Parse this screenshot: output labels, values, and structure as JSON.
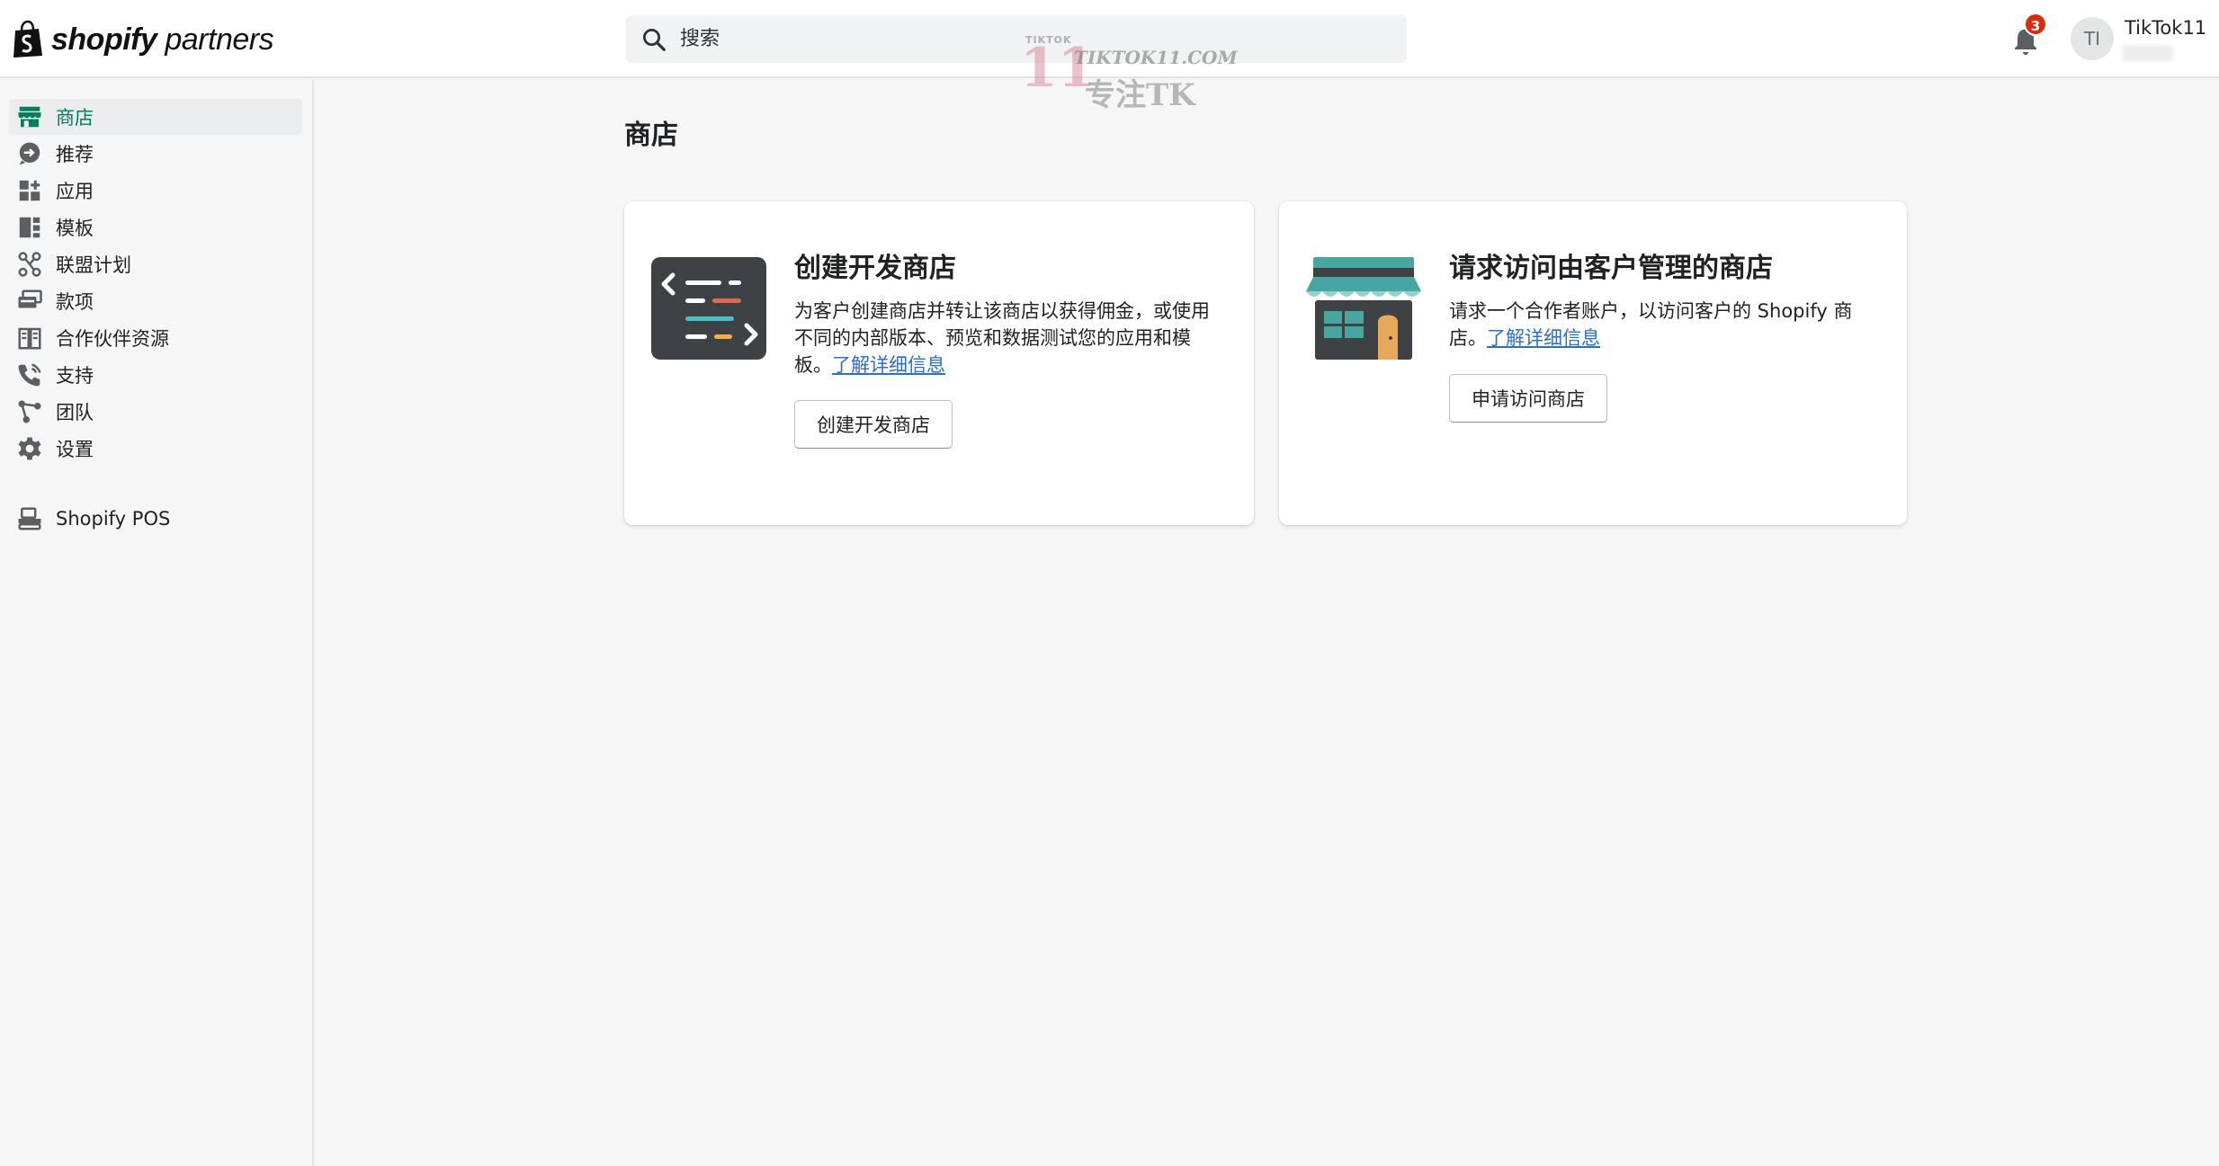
{
  "header": {
    "logo_bold": "shopify",
    "logo_light": "partners",
    "search_placeholder": "搜索",
    "notification_count": "3",
    "avatar_initials": "TI",
    "user_name": "TikTok11"
  },
  "watermark": {
    "small": "TIKTOK",
    "number": "11",
    "site": "TIKTOK11.COM",
    "tagline": "专注TK"
  },
  "sidebar": {
    "items": [
      {
        "label": "商店",
        "icon": "store-icon",
        "active": true
      },
      {
        "label": "推荐",
        "icon": "referral-icon"
      },
      {
        "label": "应用",
        "icon": "apps-icon"
      },
      {
        "label": "模板",
        "icon": "themes-icon"
      },
      {
        "label": "联盟计划",
        "icon": "affiliate-icon"
      },
      {
        "label": "款项",
        "icon": "payouts-icon"
      },
      {
        "label": "合作伙伴资源",
        "icon": "resources-icon"
      },
      {
        "label": "支持",
        "icon": "support-icon"
      },
      {
        "label": "团队",
        "icon": "team-icon"
      },
      {
        "label": "设置",
        "icon": "settings-icon"
      }
    ],
    "pos_label": "Shopify POS"
  },
  "main": {
    "page_title": "商店",
    "cards": [
      {
        "title": "创建开发商店",
        "description": "为客户创建商店并转让该商店以获得佣金，或使用不同的内部版本、预览和数据测试您的应用和模板。",
        "link": "了解详细信息",
        "button": "创建开发商店"
      },
      {
        "title": "请求访问由客户管理的商店",
        "description": "请求一个合作者账户，以访问客户的 Shopify 商店。",
        "link": "了解详细信息",
        "button": "申请访问商店"
      }
    ]
  },
  "colors": {
    "accent_green": "#007f5f",
    "link_blue": "#2c6ecb",
    "badge_red": "#d72c0d",
    "store_teal": "#47a7a0"
  }
}
